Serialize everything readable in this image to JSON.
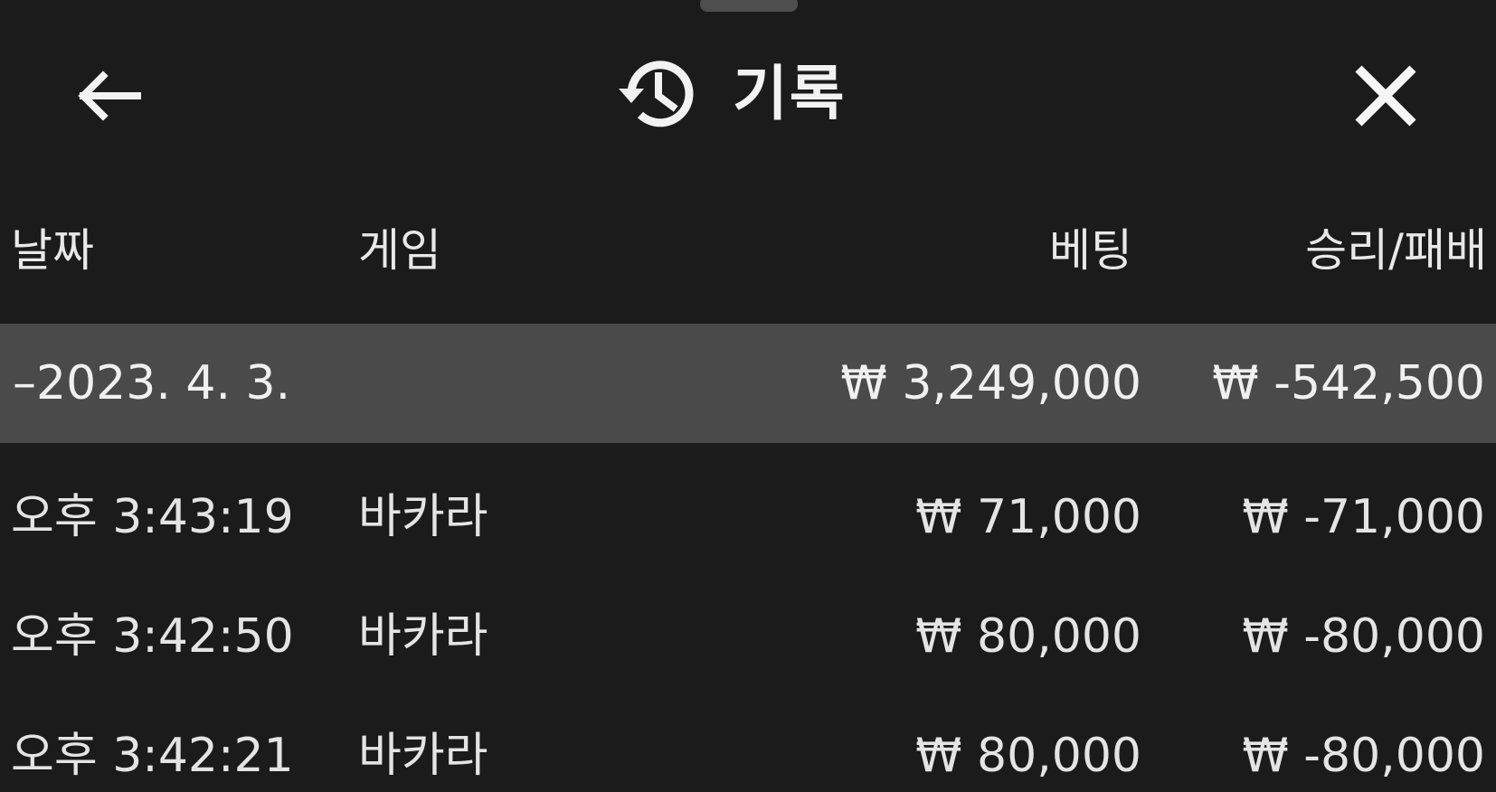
{
  "header": {
    "title": "기록",
    "back_icon": "arrow-left-icon",
    "history_icon": "history-icon",
    "close_icon": "close-icon"
  },
  "columns": {
    "date": "날짜",
    "game": "게임",
    "bet": "베팅",
    "win_loss": "승리/패배"
  },
  "summary": {
    "date": "–2023. 4. 3.",
    "bet": "₩ 3,249,000",
    "win_loss": "₩ -542,500"
  },
  "rows": [
    {
      "time": "오후 3:43:19",
      "game": "바카라",
      "bet": "₩ 71,000",
      "win_loss": "₩ -71,000"
    },
    {
      "time": "오후 3:42:50",
      "game": "바카라",
      "bet": "₩ 80,000",
      "win_loss": "₩ -80,000"
    },
    {
      "time": "오후 3:42:21",
      "game": "바카라",
      "bet": "₩ 80,000",
      "win_loss": "₩ -80,000"
    }
  ],
  "colors": {
    "background": "#1b1b1b",
    "summary_row": "#4a4a4a",
    "text": "#e4e4e4"
  }
}
